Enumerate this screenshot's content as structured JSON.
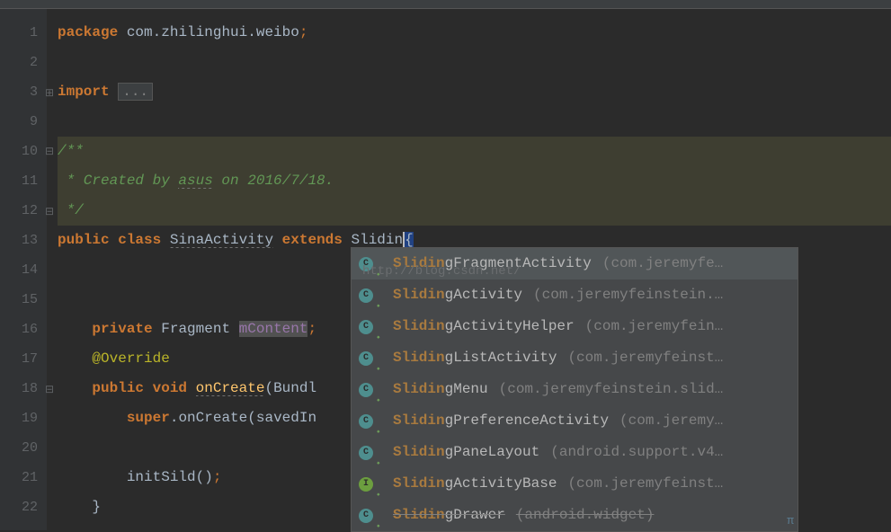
{
  "gutter": {
    "lines": [
      "1",
      "2",
      "3",
      "9",
      "10",
      "11",
      "12",
      "13",
      "14",
      "15",
      "16",
      "17",
      "18",
      "19",
      "20",
      "21",
      "22"
    ]
  },
  "code": {
    "l1_package": "package",
    "l1_pkg_path": "com.zhilinghui.weibo",
    "l1_semi": ";",
    "l3_import": "import",
    "l3_fold": "...",
    "l10_open": "/**",
    "l11_body": " * Created by ",
    "l11_author": "asus",
    "l11_rest": " on 2016/7/18.",
    "l12_close": " */",
    "l13_public": "public",
    "l13_class": "class",
    "l13_name": "SinaActivity",
    "l13_extends": "extends",
    "l13_super_partial": "Slidin",
    "l13_brace": "{",
    "l16_private": "private",
    "l16_type": "Fragment",
    "l16_field": "mContent",
    "l16_semi": ";",
    "l17_anno": "@Override",
    "l18_public": "public",
    "l18_void": "void",
    "l18_method": "onCreate",
    "l18_paren_open": "(",
    "l18_param_type": "Bundl",
    "l19_super": "super",
    "l19_dot": ".",
    "l19_method": "onCreate",
    "l19_paren_open": "(",
    "l19_arg": "savedIn",
    "l21_call": "initSild",
    "l21_parens": "()",
    "l21_semi": ";",
    "l22_brace": "}"
  },
  "completion": {
    "watermark": "http://blog.csdn.net/",
    "items": [
      {
        "icon": "C",
        "iconType": "class",
        "match": "Slidin",
        "rest": "gFragmentActivity",
        "pkg": "(com.jeremyfe…",
        "strike": false,
        "selected": true
      },
      {
        "icon": "C",
        "iconType": "class",
        "match": "Slidin",
        "rest": "gActivity",
        "pkg": "(com.jeremyfeinstein.…",
        "strike": false,
        "selected": false
      },
      {
        "icon": "C",
        "iconType": "class",
        "match": "Slidin",
        "rest": "gActivityHelper",
        "pkg": "(com.jeremyfein…",
        "strike": false,
        "selected": false
      },
      {
        "icon": "C",
        "iconType": "class",
        "match": "Slidin",
        "rest": "gListActivity",
        "pkg": "(com.jeremyfeinst…",
        "strike": false,
        "selected": false
      },
      {
        "icon": "C",
        "iconType": "class",
        "match": "Slidin",
        "rest": "gMenu",
        "pkg": "(com.jeremyfeinstein.slid…",
        "strike": false,
        "selected": false
      },
      {
        "icon": "C",
        "iconType": "class",
        "match": "Slidin",
        "rest": "gPreferenceActivity",
        "pkg": "(com.jeremy…",
        "strike": false,
        "selected": false
      },
      {
        "icon": "C",
        "iconType": "class",
        "match": "Slidin",
        "rest": "gPaneLayout",
        "pkg": "(android.support.v4…",
        "strike": false,
        "selected": false
      },
      {
        "icon": "I",
        "iconType": "interface",
        "match": "Slidin",
        "rest": "gActivityBase",
        "pkg": "(com.jeremyfeinst…",
        "strike": false,
        "selected": false
      },
      {
        "icon": "C",
        "iconType": "class",
        "match": "Slidin",
        "rest": "gDrawer",
        "pkg": "(android.widget)",
        "strike": true,
        "selected": false
      }
    ]
  },
  "misc": {
    "pi": "π"
  }
}
